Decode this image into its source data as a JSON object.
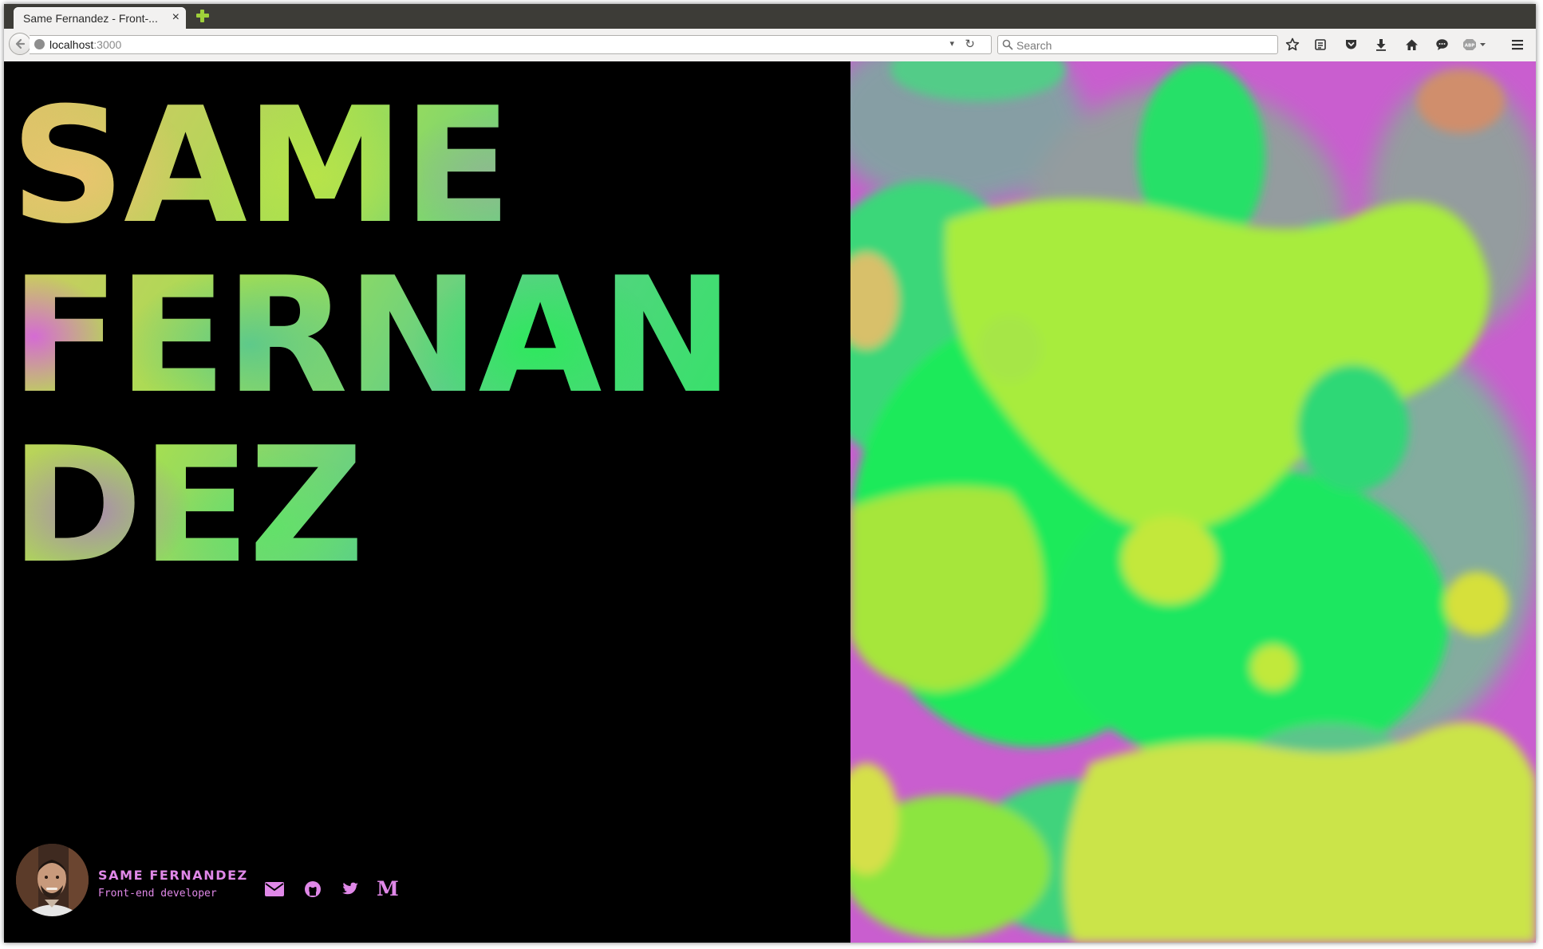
{
  "browser": {
    "tab_title": "Same Fernandez - Front-...",
    "tab_close": "×",
    "url_host": "localhost",
    "url_port": ":3000",
    "search_placeholder": "Search",
    "url_dropdown": "▾",
    "reload": "↻"
  },
  "page": {
    "name_lines": [
      "SAME",
      "FERNAN",
      "DEZ"
    ],
    "author_name": "SAME FERNANDEZ",
    "author_role": "Front-end developer",
    "social_links": [
      "email-icon",
      "github-icon",
      "twitter-icon",
      "medium-icon"
    ],
    "medium_label": "M",
    "accent_color": "#e088e8",
    "background_color": "#000000",
    "artwork_colors": [
      "#c85fd0",
      "#1ee85a",
      "#a8ef3b",
      "#55c98a",
      "#d0e04a"
    ]
  }
}
